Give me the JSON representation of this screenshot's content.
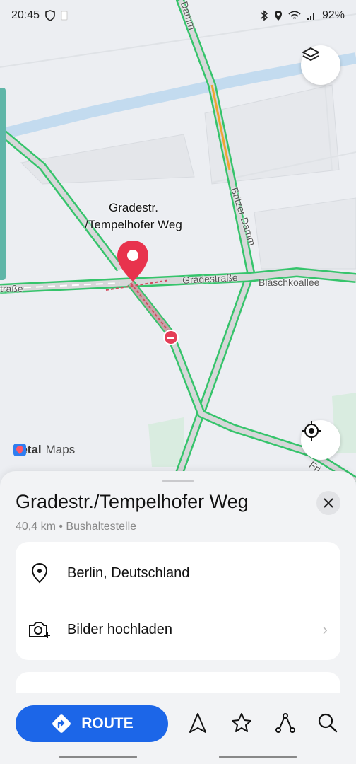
{
  "status_bar": {
    "time": "20:45",
    "battery": "92%",
    "left_icons": [
      "shield-icon",
      "sim-icon"
    ],
    "right_icons": [
      "bluetooth-icon",
      "location-icon",
      "wifi-icon",
      "signal-icon"
    ]
  },
  "map": {
    "pin_label_line1": "Gradestr.",
    "pin_label_line2": "/Tempelhofer Weg",
    "road_labels": {
      "gradestrasse": "Gradestraße",
      "blaschkoallee": "Blaschkoallee",
      "britzer_damm": "Britzer Damm",
      "strasse_left": "traße",
      "damm_top": "Damm",
      "ffi": "Fri"
    },
    "logo_brand": "Petal",
    "logo_word": "Maps",
    "layers_icon": "layers-icon",
    "locate_icon": "crosshair-icon",
    "colors": {
      "traffic_green": "#35c46b",
      "water": "#c3dbef",
      "pin": "#e8334d"
    }
  },
  "sheet": {
    "title": "Gradestr./Tempelhofer Weg",
    "subtitle": "40,4 km • Bushaltestelle",
    "address": "Berlin, Deutschland",
    "upload_label": "Bilder hochladen",
    "close_icon": "close-icon"
  },
  "bottom_bar": {
    "route_label": "ROUTE",
    "accent": "#1c66e8",
    "icons": [
      "navigate-icon",
      "star-icon",
      "share-icon",
      "search-icon"
    ]
  }
}
